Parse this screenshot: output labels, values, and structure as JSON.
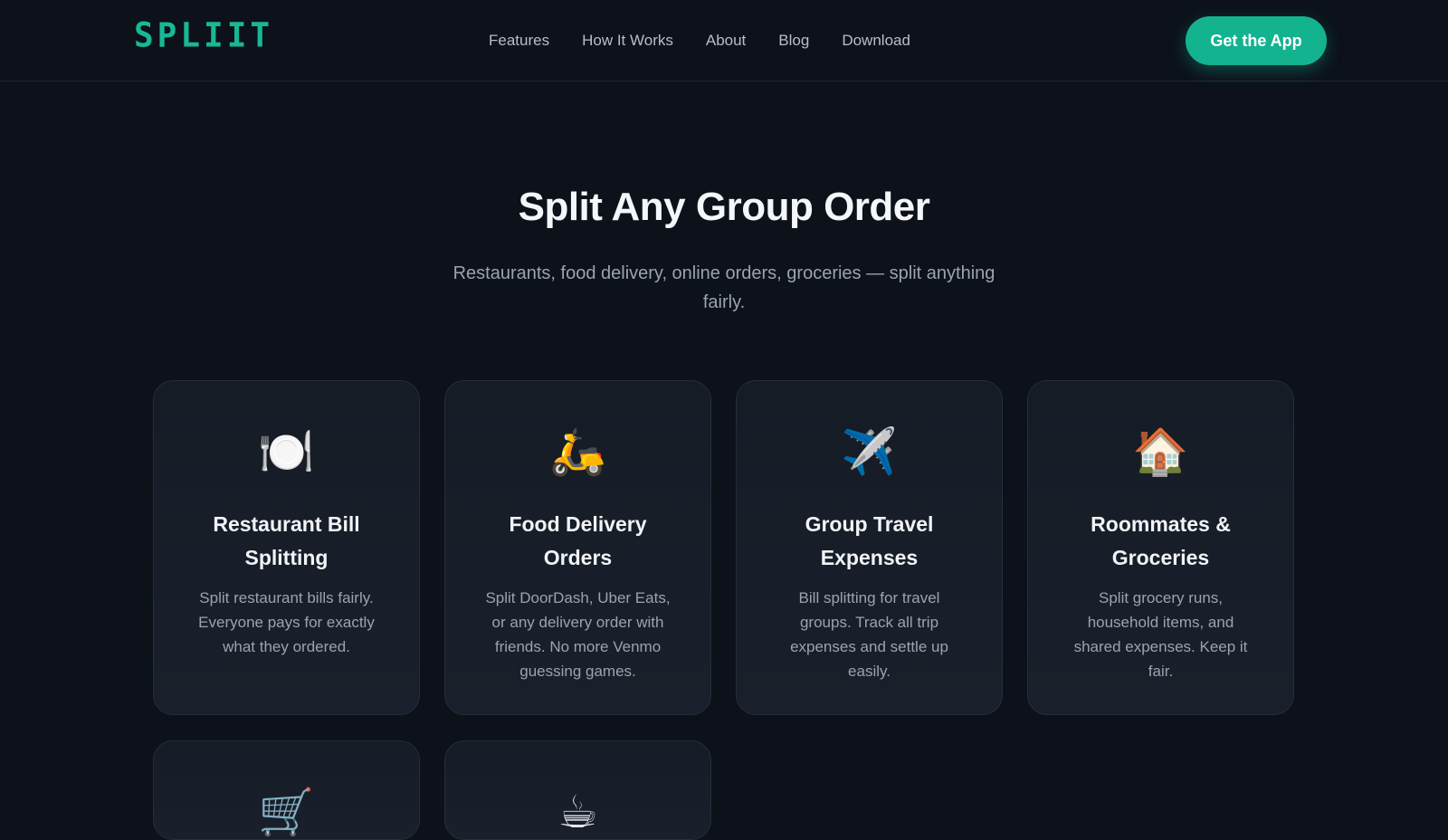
{
  "nav": {
    "logo": "SPLIIT",
    "links": [
      "Features",
      "How It Works",
      "About",
      "Blog",
      "Download"
    ],
    "cta": "Get the App"
  },
  "hero": {
    "title": "Split Any Group Order",
    "subtitle": "Restaurants, food delivery, online orders, groceries — split anything fairly."
  },
  "cards": [
    {
      "icon": "🍽️",
      "icon_name": "plate-utensils-icon",
      "title": "Restaurant Bill Splitting",
      "desc": "Split restaurant bills fairly. Everyone pays for exactly what they ordered."
    },
    {
      "icon": "🛵",
      "icon_name": "scooter-icon",
      "title": "Food Delivery Orders",
      "desc": "Split DoorDash, Uber Eats, or any delivery order with friends. No more Venmo guessing games."
    },
    {
      "icon": "✈️",
      "icon_name": "airplane-icon",
      "title": "Group Travel Expenses",
      "desc": "Bill splitting for travel groups. Track all trip expenses and settle up easily."
    },
    {
      "icon": "🏠",
      "icon_name": "house-icon",
      "title": "Roommates & Groceries",
      "desc": "Split grocery runs, household items, and shared expenses. Keep it fair."
    },
    {
      "icon": "🛒",
      "icon_name": "shopping-cart-icon"
    },
    {
      "icon": "☕",
      "icon_name": "coffee-cup-icon"
    }
  ],
  "colors": {
    "background": "#0c111a",
    "accent": "#14b390",
    "card": "#171d27",
    "muted_text": "#9aa3af"
  }
}
